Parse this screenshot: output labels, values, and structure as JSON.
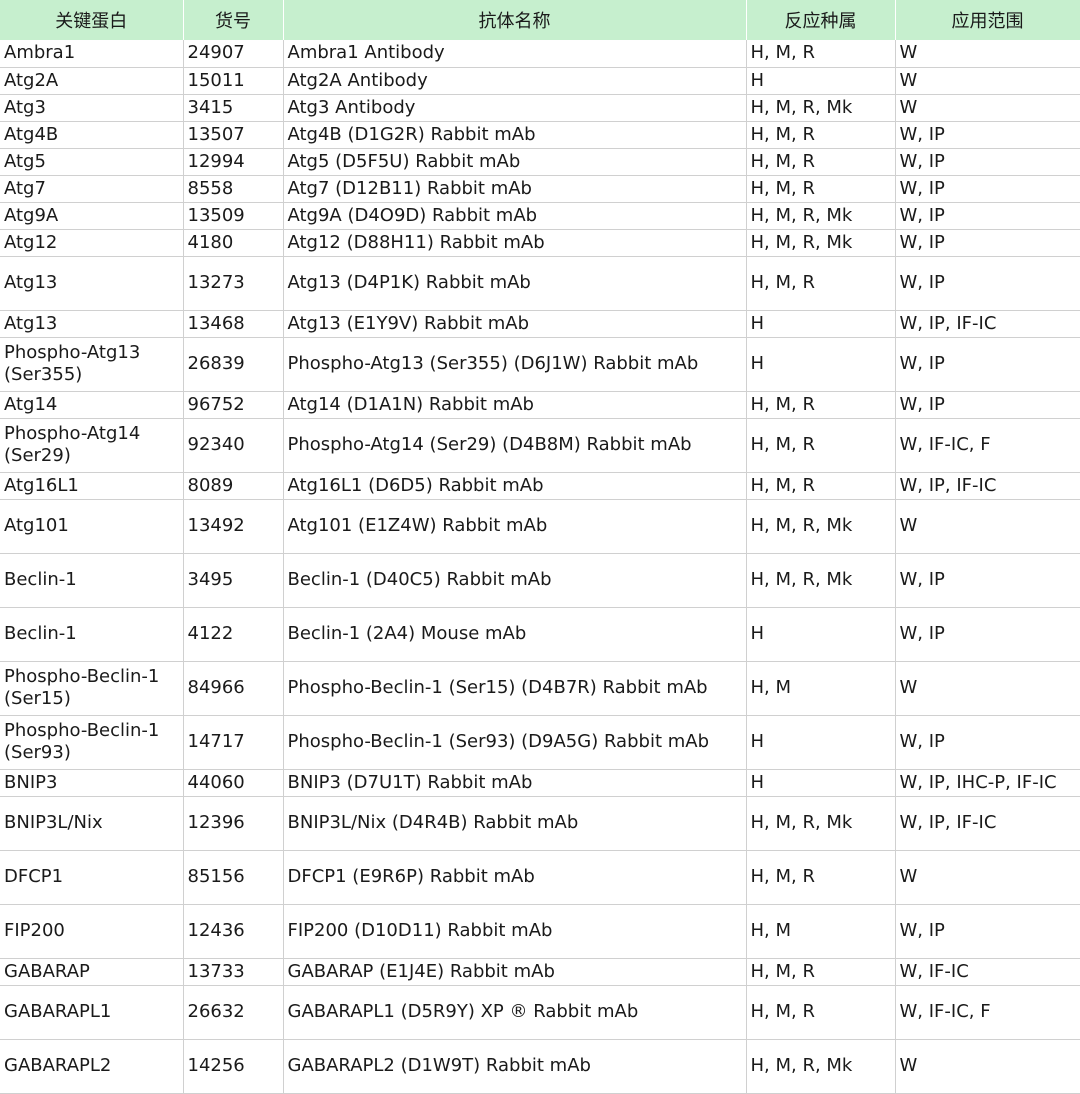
{
  "table": {
    "columns": [
      "关键蛋白",
      "货号",
      "抗体名称",
      "反应种属",
      "应用范围"
    ],
    "rows": [
      {
        "protein": "Ambra1",
        "cat": "24907",
        "name": "Ambra1 Antibody",
        "species": "H, M, R",
        "app": "W"
      },
      {
        "protein": "Atg2A",
        "cat": "15011",
        "name": "Atg2A Antibody",
        "species": "H",
        "app": "W"
      },
      {
        "protein": "Atg3",
        "cat": "3415",
        "name": "Atg3 Antibody",
        "species": "H, M, R, Mk",
        "app": "W"
      },
      {
        "protein": "Atg4B",
        "cat": "13507",
        "name": "Atg4B (D1G2R) Rabbit mAb",
        "species": "H, M, R",
        "app": "W, IP"
      },
      {
        "protein": "Atg5",
        "cat": "12994",
        "name": "Atg5 (D5F5U) Rabbit mAb",
        "species": "H, M, R",
        "app": "W, IP"
      },
      {
        "protein": "Atg7",
        "cat": "8558",
        "name": "Atg7 (D12B11) Rabbit mAb",
        "species": "H, M, R",
        "app": "W, IP"
      },
      {
        "protein": "Atg9A",
        "cat": "13509",
        "name": "Atg9A (D4O9D) Rabbit mAb",
        "species": "H, M, R, Mk",
        "app": "W, IP"
      },
      {
        "protein": "Atg12",
        "cat": "4180",
        "name": "Atg12 (D88H11) Rabbit mAb",
        "species": "H, M, R, Mk",
        "app": "W, IP"
      },
      {
        "protein": "Atg13",
        "cat": "13273",
        "name": "Atg13 (D4P1K) Rabbit mAb",
        "species": "H, M, R",
        "app": "W, IP"
      },
      {
        "protein": "Atg13",
        "cat": "13468",
        "name": "Atg13 (E1Y9V) Rabbit mAb",
        "species": "H",
        "app": "W, IP, IF-IC"
      },
      {
        "protein": "Phospho-Atg13 (Ser355)",
        "cat": "26839",
        "name": "Phospho-Atg13 (Ser355) (D6J1W) Rabbit mAb",
        "species": "H",
        "app": "W, IP"
      },
      {
        "protein": "Atg14",
        "cat": "96752",
        "name": "Atg14 (D1A1N) Rabbit mAb",
        "species": "H, M, R",
        "app": "W, IP"
      },
      {
        "protein": "Phospho-Atg14 (Ser29)",
        "cat": "92340",
        "name": "Phospho-Atg14 (Ser29) (D4B8M) Rabbit mAb",
        "species": "H, M, R",
        "app": "W, IF-IC, F"
      },
      {
        "protein": "Atg16L1",
        "cat": "8089",
        "name": "Atg16L1 (D6D5) Rabbit mAb",
        "species": "H, M, R",
        "app": "W, IP, IF-IC"
      },
      {
        "protein": "Atg101",
        "cat": "13492",
        "name": "Atg101 (E1Z4W) Rabbit mAb",
        "species": "H, M, R, Mk",
        "app": "W"
      },
      {
        "protein": "Beclin-1",
        "cat": "3495",
        "name": "Beclin-1 (D40C5) Rabbit mAb",
        "species": "H, M, R, Mk",
        "app": "W, IP"
      },
      {
        "protein": "Beclin-1",
        "cat": "4122",
        "name": "Beclin-1 (2A4) Mouse mAb",
        "species": "H",
        "app": "W, IP"
      },
      {
        "protein": "Phospho-Beclin-1 (Ser15)",
        "cat": "84966",
        "name": "Phospho-Beclin-1 (Ser15) (D4B7R) Rabbit mAb",
        "species": "H, M",
        "app": "W"
      },
      {
        "protein": "Phospho-Beclin-1 (Ser93)",
        "cat": "14717",
        "name": "Phospho-Beclin-1 (Ser93) (D9A5G) Rabbit mAb",
        "species": "H",
        "app": "W, IP"
      },
      {
        "protein": "BNIP3",
        "cat": "44060",
        "name": "BNIP3 (D7U1T) Rabbit mAb",
        "species": "H",
        "app": "W, IP, IHC-P, IF-IC"
      },
      {
        "protein": "BNIP3L/Nix",
        "cat": "12396",
        "name": "BNIP3L/Nix (D4R4B) Rabbit mAb",
        "species": "H, M, R, Mk",
        "app": "W, IP, IF-IC"
      },
      {
        "protein": "DFCP1",
        "cat": "85156",
        "name": "DFCP1 (E9R6P) Rabbit mAb",
        "species": "H, M, R",
        "app": "W"
      },
      {
        "protein": "FIP200",
        "cat": "12436",
        "name": "FIP200 (D10D11) Rabbit mAb",
        "species": "H, M",
        "app": "W, IP"
      },
      {
        "protein": "GABARAP",
        "cat": "13733",
        "name": "GABARAP (E1J4E) Rabbit mAb",
        "species": "H, M, R",
        "app": "W, IF-IC"
      },
      {
        "protein": "GABARAPL1",
        "cat": "26632",
        "name": "GABARAPL1 (D5R9Y) XP ®  Rabbit mAb",
        "species": "H, M, R",
        "app": "W, IF-IC, F"
      },
      {
        "protein": "GABARAPL2",
        "cat": "14256",
        "name": "GABARAPL2 (D1W9T) Rabbit mAb",
        "species": "H, M, R, Mk",
        "app": "W"
      }
    ]
  }
}
